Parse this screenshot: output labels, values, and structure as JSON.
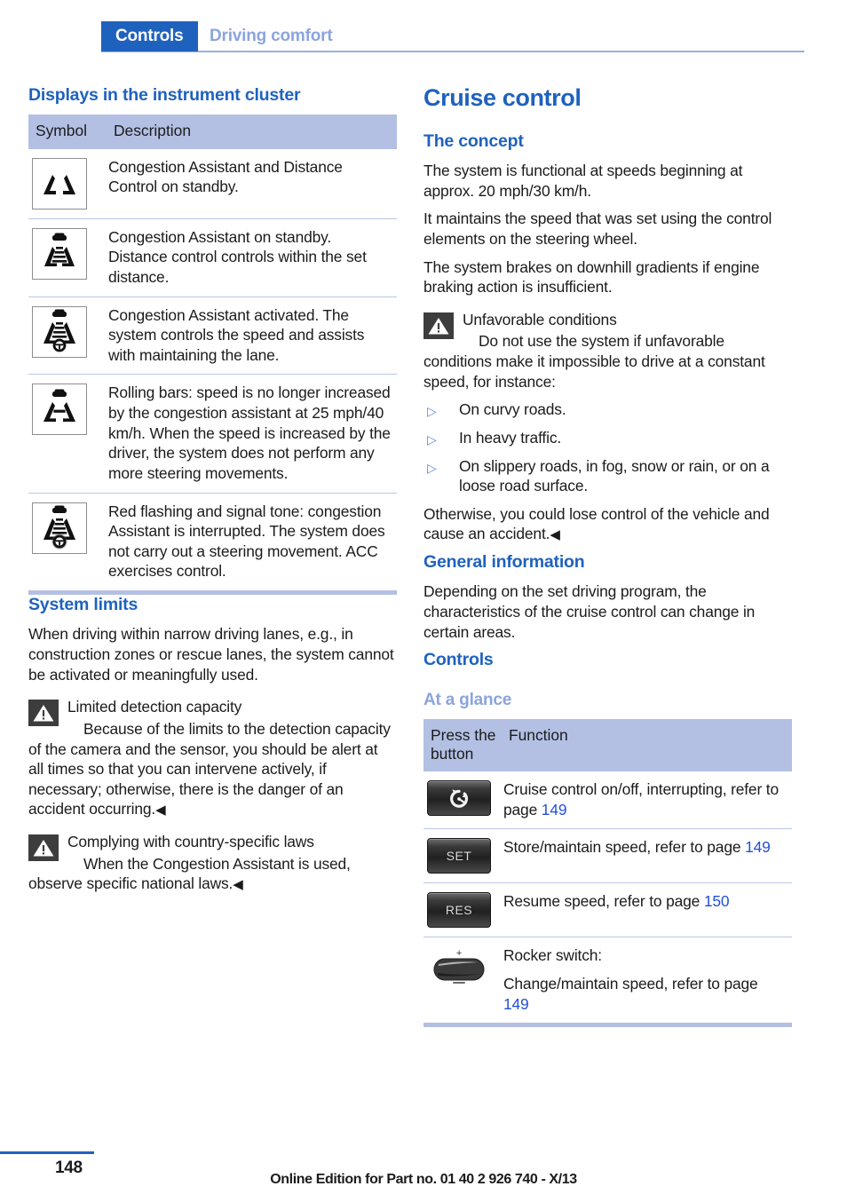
{
  "running_header": {
    "chapter_tab": "Controls",
    "section": "Driving comfort"
  },
  "left_column": {
    "heading": "Displays in the instrument cluster",
    "symbol_table": {
      "columns": [
        "Symbol",
        "Description"
      ],
      "rows": [
        {
          "symbol": "lane-markings-standby-icon",
          "description": "Congestion Assistant and Distance Control on standby."
        },
        {
          "symbol": "car-with-bars-standby-icon",
          "description": "Congestion Assistant on standby. Distance control controls within the set distance."
        },
        {
          "symbol": "car-with-bars-steering-wheel-icon",
          "description": "Congestion Assistant activated. The system controls the speed and assists with maintaining the lane."
        },
        {
          "symbol": "car-rolling-bars-icon",
          "description": "Rolling bars: speed is no longer increased by the congestion assistant at 25 mph/40 km/h. When the speed is increased by the driver, the system does not perform any more steering movements."
        },
        {
          "symbol": "car-with-bars-steering-wheel-red-icon",
          "description": "Red flashing and signal tone: congestion Assistant is interrupted. The system does not carry out a steering movement. ACC exercises control."
        }
      ]
    },
    "system_limits": {
      "heading": "System limits",
      "paragraph": "When driving within narrow driving lanes, e.g., in construction zones or rescue lanes, the system cannot be activated or meaningfully used.",
      "warning_1": {
        "title": "Limited detection capacity",
        "body": "Because of the limits to the detection capacity of the camera and the sensor, you should be alert at all times so that you can intervene actively, if necessary; otherwise, there is the danger of an accident occurring.",
        "end_mark": "◀"
      },
      "warning_2": {
        "title": "Complying with country-specific laws",
        "body": "When the Congestion Assistant is used, observe specific national laws.",
        "end_mark": "◀"
      }
    }
  },
  "right_column": {
    "chapter_title": "Cruise control",
    "the_concept": {
      "heading": "The concept",
      "paragraphs": [
        "The system is functional at speeds beginning at approx. 20 mph/30 km/h.",
        "It maintains the speed that was set using the control elements on the steering wheel.",
        "The system brakes on downhill gradients if engine braking action is insufficient."
      ],
      "warning": {
        "title": "Unfavorable conditions",
        "body": "Do not use the system if unfavorable conditions make it impossible to drive at a constant speed, for instance:",
        "bullets": [
          "On curvy roads.",
          "In heavy traffic.",
          "On slippery roads, in fog, snow or rain, or on a loose road surface."
        ],
        "closing": "Otherwise, you could lose control of the vehicle and cause an accident.",
        "end_mark": "◀"
      }
    },
    "general_information": {
      "heading": "General information",
      "paragraph": "Depending on the set driving program, the characteristics of the cruise control can change in certain areas."
    },
    "controls": {
      "heading": "Controls",
      "subheading": "At a glance",
      "table": {
        "columns": [
          "Press the button",
          "Function"
        ],
        "rows": [
          {
            "button_icon": "cruise-control-on-off-icon",
            "button_label": "",
            "function_pre": "Cruise control on/off, interrupting, refer to page ",
            "page": "149",
            "function_post": ""
          },
          {
            "button_icon": "set-button-icon",
            "button_label": "SET",
            "function_pre": "Store/maintain speed, refer to page ",
            "page": "149",
            "function_post": ""
          },
          {
            "button_icon": "res-button-icon",
            "button_label": "RES",
            "function_pre": "Resume speed, refer to page ",
            "page": "150",
            "function_post": ""
          },
          {
            "button_icon": "rocker-switch-icon",
            "button_label": "",
            "function_pre": "Rocker switch:",
            "function_line2_pre": "Change/maintain speed, refer to page ",
            "page": "149",
            "function_post": ""
          }
        ]
      }
    }
  },
  "footer": {
    "page_number": "148",
    "edition_note": "Online Edition for Part no. 01 40 2 926 740 - X/13"
  },
  "colors": {
    "brand_blue": "#1f62bd",
    "light_blue": "#8ba4dd",
    "table_header_bg": "#b3c0e4",
    "page_ref_blue": "#2351d6",
    "rule_blue": "#b9c6e6"
  }
}
